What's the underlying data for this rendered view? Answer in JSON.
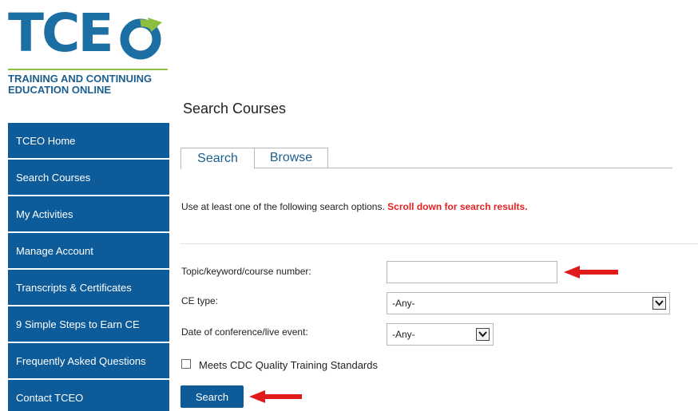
{
  "logo": {
    "letters": "TCE",
    "tagline_line1": "TRAINING AND CONTINUING",
    "tagline_line2": "EDUCATION ONLINE"
  },
  "sidebar": {
    "items": [
      {
        "label": "TCEO Home"
      },
      {
        "label": "Search Courses"
      },
      {
        "label": "My Activities"
      },
      {
        "label": "Manage Account"
      },
      {
        "label": "Transcripts & Certificates"
      },
      {
        "label": "9 Simple Steps to Earn CE"
      },
      {
        "label": "Frequently Asked Questions"
      },
      {
        "label": "Contact TCEO"
      }
    ]
  },
  "main": {
    "title": "Search Courses",
    "tabs": [
      {
        "label": "Search",
        "active": true
      },
      {
        "label": "Browse",
        "active": false
      }
    ],
    "instructions": {
      "text": "Use at least one of the following search options. ",
      "highlight": "Scroll down for search results."
    },
    "form": {
      "topic_label": "Topic/keyword/course number:",
      "topic_value": "",
      "ce_type_label": "CE type:",
      "ce_type_value": "-Any-",
      "date_label": "Date of conference/live event:",
      "date_value": "-Any-",
      "checkbox_label": "Meets CDC Quality Training Standards",
      "checkbox_checked": false,
      "search_button": "Search"
    }
  },
  "colors": {
    "nav_bg": "#0d5b99",
    "logo_blue": "#1b6fa3",
    "logo_green": "#8cbf3f",
    "highlight_red": "#e32222",
    "arrow_red": "#e01b1b"
  },
  "icons": {
    "select_arrow": "chevron-down-icon",
    "pointer_arrow": "red-arrow-left-icon"
  }
}
